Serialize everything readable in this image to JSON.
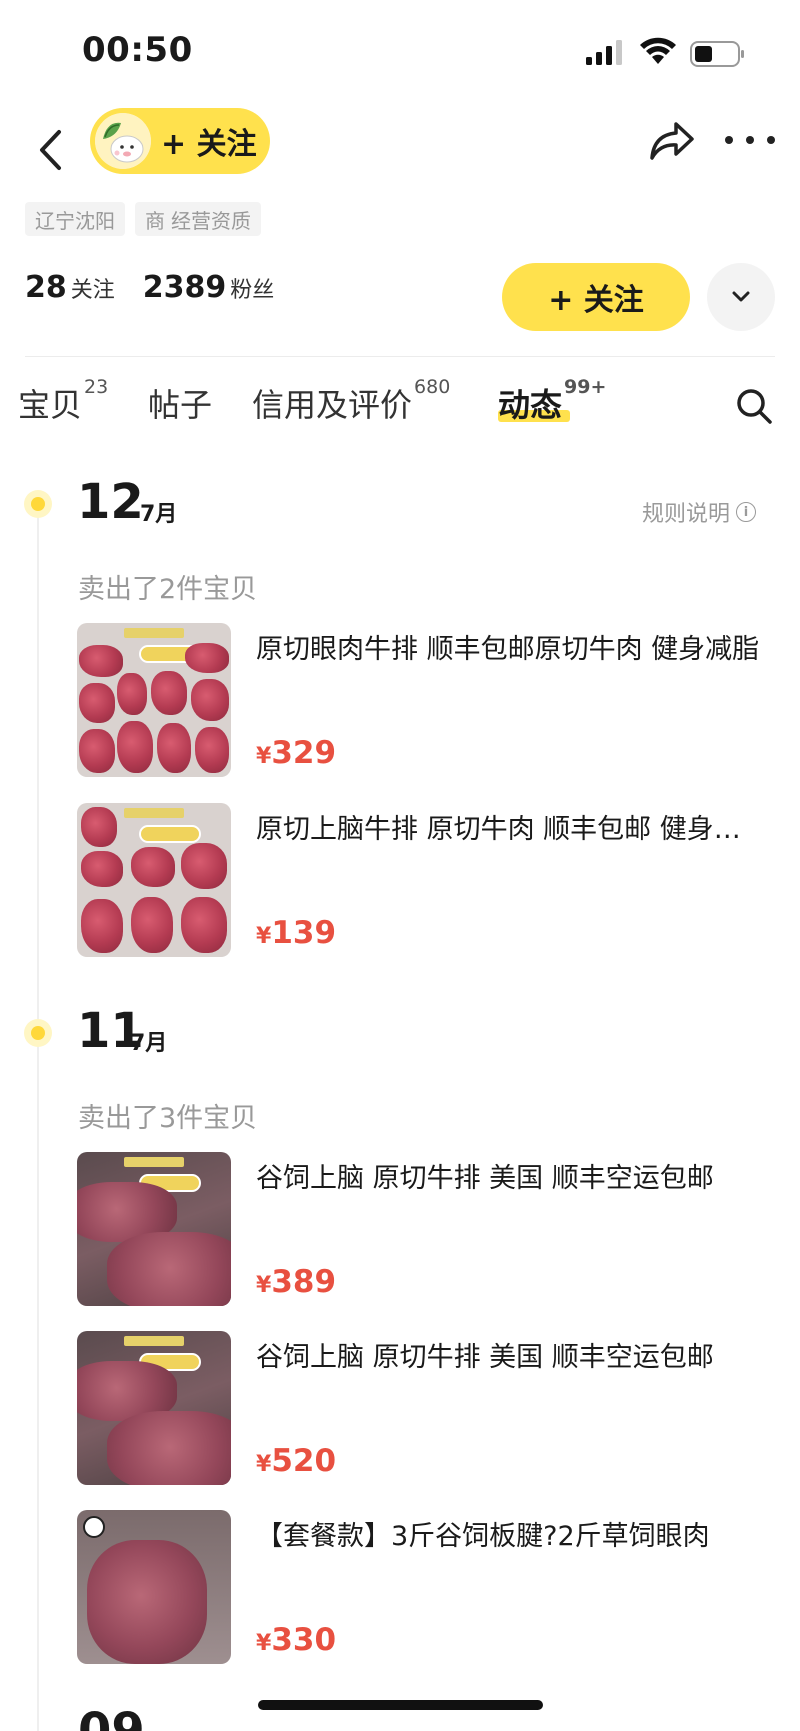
{
  "status_bar": {
    "time": "00:50"
  },
  "header": {
    "follow_pill_label": "+ 关注"
  },
  "tags": [
    {
      "label": "辽宁沈阳",
      "icon": ""
    },
    {
      "label": "经营资质",
      "icon": "商"
    }
  ],
  "stats": {
    "following_count": "28",
    "following_label": "关注",
    "fans_count": "2389",
    "fans_label": "粉丝"
  },
  "follow_button_label": "+ 关注",
  "tabs": [
    {
      "label": "宝贝",
      "badge": "23"
    },
    {
      "label": "帖子",
      "badge": ""
    },
    {
      "label": "信用及评价",
      "badge": "680"
    },
    {
      "label": "动态",
      "badge": "99+",
      "active": true
    }
  ],
  "rules_label": "规则说明",
  "timeline": [
    {
      "day": "12",
      "month": "7月",
      "sold_text": "卖出了2件宝贝",
      "items": [
        {
          "title": "原切眼肉牛排 顺丰包邮原切牛肉 健身减脂",
          "price_symbol": "¥",
          "price": "329"
        },
        {
          "title": "原切上脑牛排 原切牛肉 顺丰包邮 健身减脂",
          "price_symbol": "¥",
          "price": "139"
        }
      ]
    },
    {
      "day": "11",
      "month": "7月",
      "sold_text": "卖出了3件宝贝",
      "items": [
        {
          "title": "谷饲上脑 原切牛排 美国 顺丰空运包邮",
          "price_symbol": "¥",
          "price": "389"
        },
        {
          "title": "谷饲上脑 原切牛排 美国 顺丰空运包邮",
          "price_symbol": "¥",
          "price": "520"
        },
        {
          "title": "【套餐款】3斤谷饲板腱?2斤草饲眼肉",
          "price_symbol": "¥",
          "price": "330"
        }
      ]
    }
  ],
  "next_day_partial": "09"
}
